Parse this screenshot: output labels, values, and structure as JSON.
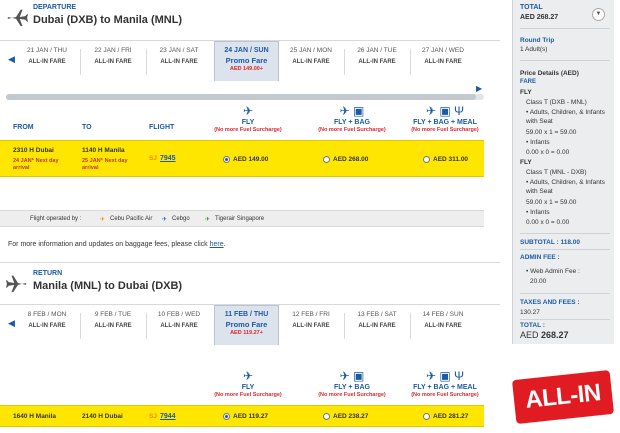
{
  "departure": {
    "kicker": "DEPARTURE",
    "route": "Dubai (DXB) to Manila (MNL)",
    "dates": [
      {
        "date": "21 JAN / THU",
        "fare": "ALL-IN FARE"
      },
      {
        "date": "22 JAN / FRI",
        "fare": "ALL-IN FARE"
      },
      {
        "date": "23 JAN / SAT",
        "fare": "ALL-IN FARE"
      },
      {
        "date": "24 JAN / SUN",
        "promo": "Promo Fare",
        "promo_price": "AED 149.00+"
      },
      {
        "date": "25 JAN / MON",
        "fare": "ALL-IN FARE"
      },
      {
        "date": "26 JAN / TUE",
        "fare": "ALL-IN FARE"
      },
      {
        "date": "27 JAN / WED",
        "fare": "ALL-IN FARE"
      }
    ],
    "fare_types": [
      {
        "name": "FLY",
        "surcharge": "(No more Fuel Surcharge)"
      },
      {
        "name": "FLY + BAG",
        "surcharge": "(No more Fuel Surcharge)"
      },
      {
        "name": "FLY + BAG + MEAL",
        "surcharge": "(No more Fuel Surcharge)"
      }
    ],
    "columns": {
      "from": "FROM",
      "to": "TO",
      "flight": "FLIGHT"
    },
    "flight": {
      "dep_time": "2310 H",
      "dep_city": "Dubai",
      "dep_date": "24 JAN*",
      "dep_note": "Next day arrival",
      "arr_time": "1140 H",
      "arr_city": "Manila",
      "arr_date": "25 JAN*",
      "arr_note": "Next day arrival",
      "carrier": "SJ",
      "number": "7945",
      "prices": [
        "AED 149.00",
        "AED 268.00",
        "AED 311.00"
      ]
    }
  },
  "operated": {
    "label": "Flight operated by :",
    "carriers": [
      "Cebu Pacific Air",
      "Cebgo",
      "Tigerair Singapore"
    ]
  },
  "note": {
    "text": "For more information and updates on baggage fees, please click ",
    "link": "here",
    "end": "."
  },
  "return": {
    "kicker": "RETURN",
    "route": "Manila (MNL) to Dubai (DXB)",
    "dates": [
      {
        "date": "8 FEB / MON",
        "fare": "ALL-IN FARE"
      },
      {
        "date": "9 FEB / TUE",
        "fare": "ALL-IN FARE"
      },
      {
        "date": "10 FEB / WED",
        "fare": "ALL-IN FARE"
      },
      {
        "date": "11 FEB / THU",
        "promo": "Promo Fare",
        "promo_price": "AED 119.27+"
      },
      {
        "date": "12 FEB / FRI",
        "fare": "ALL-IN FARE"
      },
      {
        "date": "13 FEB / SAT",
        "fare": "ALL-IN FARE"
      },
      {
        "date": "14 FEB / SUN",
        "fare": "ALL-IN FARE"
      }
    ],
    "fare_types": [
      {
        "name": "FLY",
        "surcharge": "(No more Fuel Surcharge)"
      },
      {
        "name": "FLY + BAG",
        "surcharge": "(No more Fuel Surcharge)"
      },
      {
        "name": "FLY + BAG + MEAL",
        "surcharge": "(No more Fuel Surcharge)"
      }
    ],
    "flight": {
      "dep_time": "1640 H",
      "dep_city": "Manila",
      "arr_time": "2140 H",
      "arr_city": "Dubai",
      "carrier": "SJ",
      "number": "7944",
      "prices": [
        "AED 119.27",
        "AED 238.27",
        "AED 281.27"
      ]
    }
  },
  "sidebar": {
    "total_label": "TOTAL",
    "total_amount": "AED 268.27",
    "trip_type": "Round Trip",
    "pax": "1 Adult(s)",
    "price_details": "Price Details (AED)",
    "fare": "FARE",
    "fly1": "FLY",
    "class1": "Class T (DXB - MNL)",
    "pax_line1": "• Adults, Children, & Infants with Seat",
    "calc1": "59.00 x 1 = 59.00",
    "inf1": "• Infants",
    "inf_calc1": "0.00 x 0 = 0.00",
    "fly2": "FLY",
    "class2": "Class T (MNL - DXB)",
    "pax_line2": "• Adults, Children, & Infants with Seat",
    "calc2": "59.00 x 1 = 59.00",
    "inf2": "• Infants",
    "inf_calc2": "0.00 x 0 = 0.00",
    "subtotal": "SUBTOTAL : 118.00",
    "admin_fee": "ADMIN FEE :",
    "web_admin": "• Web Admin Fee :",
    "web_admin_val": "20.00",
    "taxes": "TAXES AND FEES :",
    "taxes_val": "130.27",
    "total2_label": "TOTAL :",
    "total2_currency": "AED",
    "total2_amount": "268.27"
  },
  "badge": "ALL-IN",
  "colors": {
    "accent": "#1b5aa6",
    "highlight": "#ffe600",
    "alert": "#d8292f"
  },
  "icons": [
    "plane-icon",
    "bag-icon",
    "meal-icon",
    "chevron-down-icon"
  ]
}
